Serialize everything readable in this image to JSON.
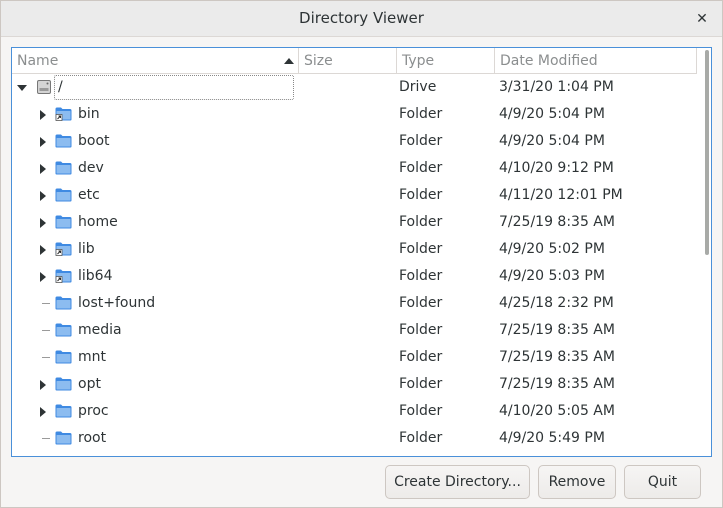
{
  "window": {
    "title": "Directory Viewer",
    "close_glyph": "✕"
  },
  "columns": {
    "name": "Name",
    "size": "Size",
    "type": "Type",
    "date": "Date Modified"
  },
  "root": {
    "name": "/",
    "type": "Drive",
    "date": "3/31/20 1:04 PM",
    "icon": "drive-icon",
    "expanded": true
  },
  "items": [
    {
      "name": "bin",
      "type": "Folder",
      "date": "4/9/20 5:04 PM",
      "expandable": true,
      "link": true
    },
    {
      "name": "boot",
      "type": "Folder",
      "date": "4/9/20 5:04 PM",
      "expandable": true,
      "link": false
    },
    {
      "name": "dev",
      "type": "Folder",
      "date": "4/10/20 9:12 PM",
      "expandable": true,
      "link": false
    },
    {
      "name": "etc",
      "type": "Folder",
      "date": "4/11/20 12:01 PM",
      "expandable": true,
      "link": false
    },
    {
      "name": "home",
      "type": "Folder",
      "date": "7/25/19 8:35 AM",
      "expandable": true,
      "link": false
    },
    {
      "name": "lib",
      "type": "Folder",
      "date": "4/9/20 5:02 PM",
      "expandable": true,
      "link": true
    },
    {
      "name": "lib64",
      "type": "Folder",
      "date": "4/9/20 5:03 PM",
      "expandable": true,
      "link": true
    },
    {
      "name": "lost+found",
      "type": "Folder",
      "date": "4/25/18 2:32 PM",
      "expandable": false,
      "link": false
    },
    {
      "name": "media",
      "type": "Folder",
      "date": "7/25/19 8:35 AM",
      "expandable": false,
      "link": false
    },
    {
      "name": "mnt",
      "type": "Folder",
      "date": "7/25/19 8:35 AM",
      "expandable": false,
      "link": false
    },
    {
      "name": "opt",
      "type": "Folder",
      "date": "7/25/19 8:35 AM",
      "expandable": true,
      "link": false
    },
    {
      "name": "proc",
      "type": "Folder",
      "date": "4/10/20 5:05 AM",
      "expandable": true,
      "link": false
    },
    {
      "name": "root",
      "type": "Folder",
      "date": "4/9/20 5:49 PM",
      "expandable": false,
      "link": false
    }
  ],
  "buttons": {
    "create": "Create Directory...",
    "remove": "Remove",
    "quit": "Quit"
  },
  "colors": {
    "folder": "#3f8ae2",
    "folder_light": "#8cbcf0",
    "focus": "#4a90d9"
  }
}
